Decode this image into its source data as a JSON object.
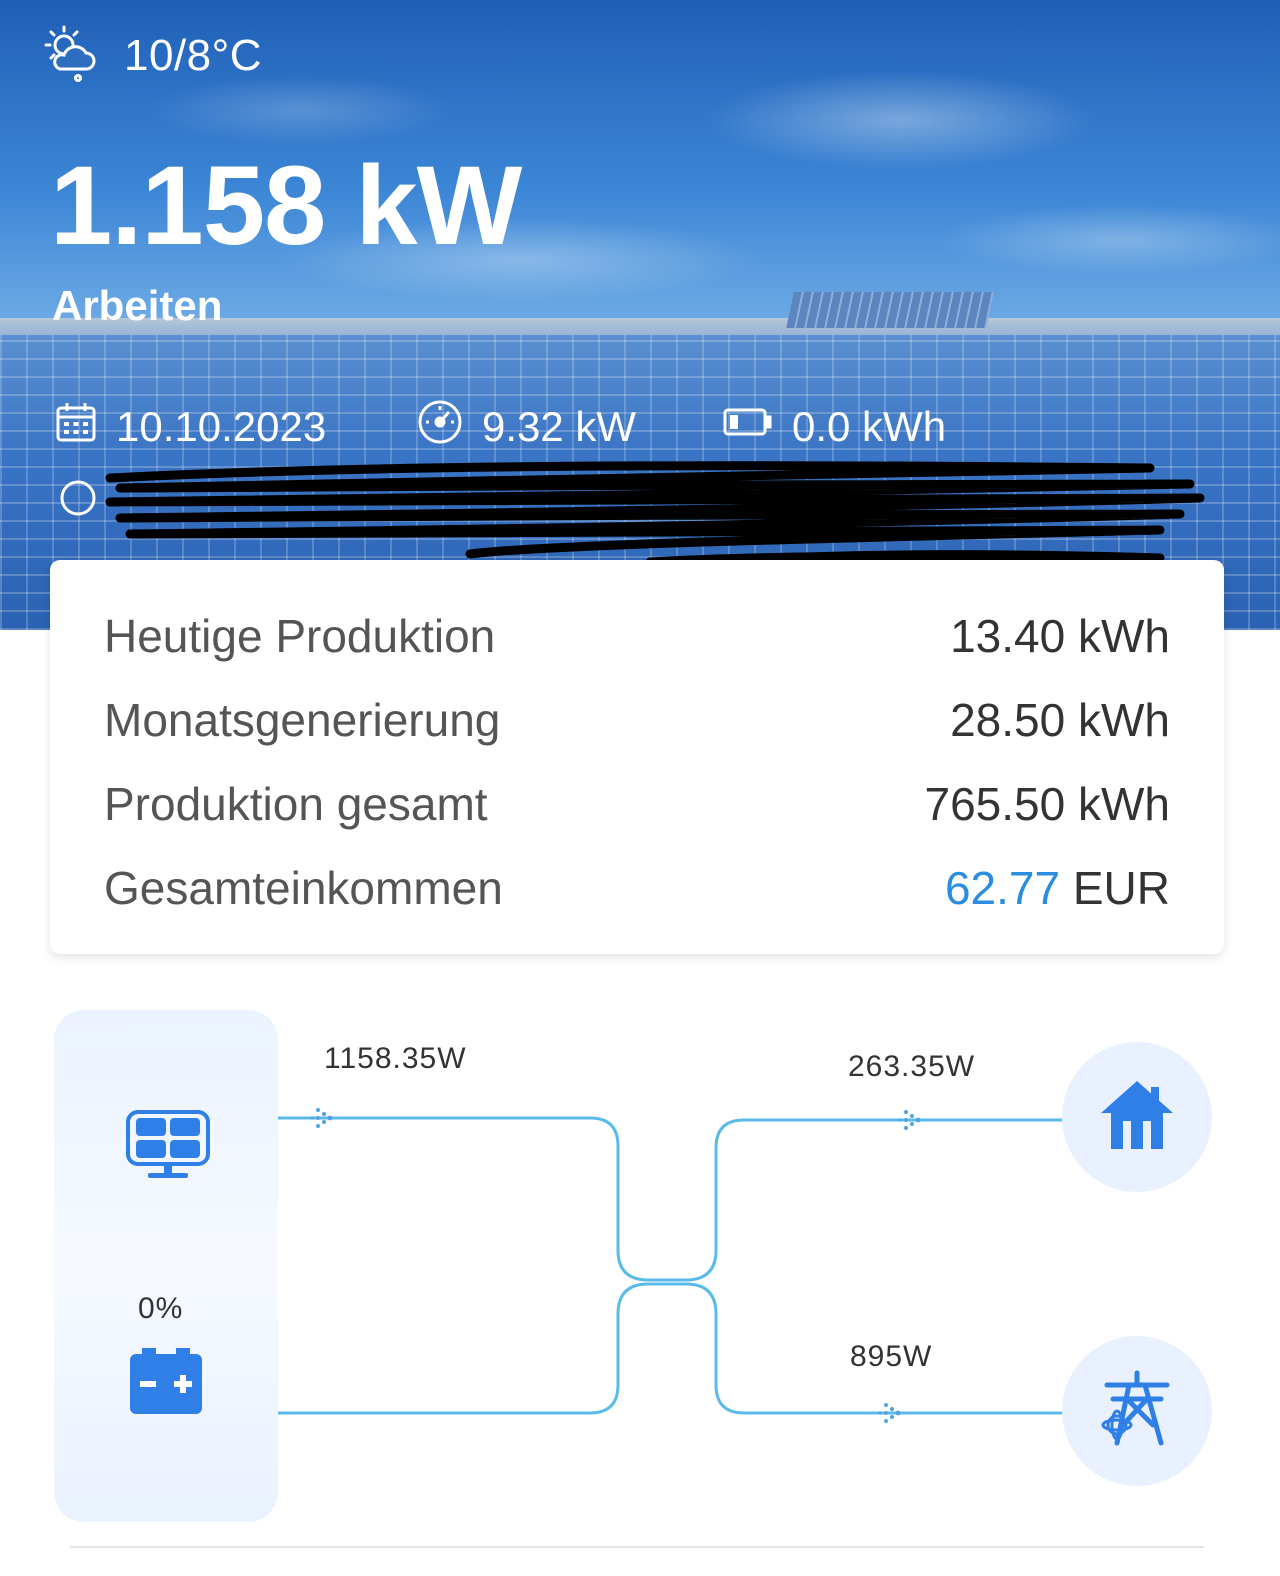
{
  "weather": {
    "temperature": "10/8°C",
    "icon": "cloudy-sun-icon"
  },
  "current_power": "1.158 kW",
  "status": "Arbeiten",
  "info": {
    "date": "10.10.2023",
    "capacity": "9.32 kW",
    "battery_energy": "0.0 kWh",
    "date_icon": "calendar-icon",
    "capacity_icon": "gauge-icon",
    "battery_icon": "battery-icon",
    "location_icon": "location-pin-icon"
  },
  "stats": [
    {
      "label": "Heutige Produktion",
      "value": "13.40 kWh"
    },
    {
      "label": "Monatsgenerierung",
      "value": "28.50 kWh"
    },
    {
      "label": "Produktion gesamt",
      "value": "765.50 kWh"
    }
  ],
  "income": {
    "label": "Gesamteinkommen",
    "amount": "62.77",
    "currency": "EUR",
    "amount_color": "#2a8de0"
  },
  "flow": {
    "pv_power": "1158.35W",
    "battery_soc": "0%",
    "home_power": "263.35W",
    "grid_power": "895W",
    "line_color": "#5bbbe8",
    "icon_color": "#2f7fe6"
  }
}
